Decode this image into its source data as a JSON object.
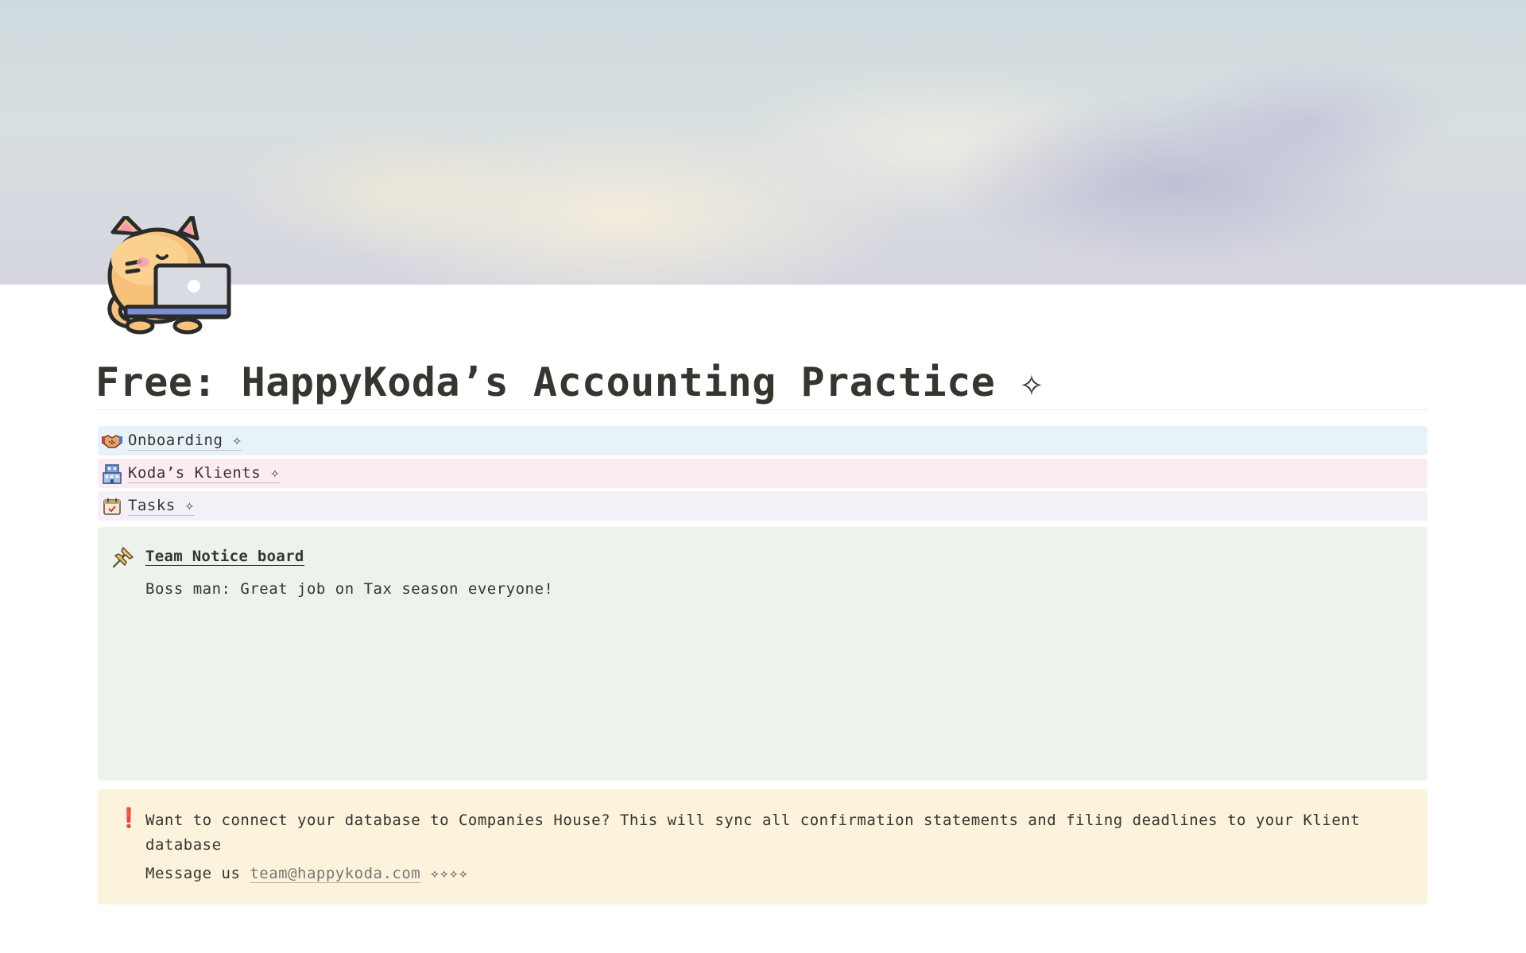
{
  "page": {
    "title": "Free: HappyKoda’s Accounting Practice ✧",
    "icon": "cat-with-laptop-icon"
  },
  "links": [
    {
      "label": "Onboarding ✧",
      "icon": "handshake-icon"
    },
    {
      "label": "Koda’s Klients ✧",
      "icon": "office-building-icon"
    },
    {
      "label": "Tasks ✧",
      "icon": "calendar-icon"
    }
  ],
  "notice_board": {
    "icon": "pushpin-icon",
    "heading": "Team Notice board",
    "body": "Boss man: Great job on Tax season everyone!"
  },
  "alert": {
    "icon": "exclamation-icon",
    "icon_glyph": "❗",
    "text": "Want to connect your database to Companies House? This will sync all confirmation statements and filing deadlines to your Klient database",
    "message_prefix": "Message us",
    "email": "team@happykoda.com",
    "message_suffix": "✧✧✧✧"
  },
  "colors": {
    "onboarding_bg": "#e7f3f8",
    "klients_bg": "#fbecf2",
    "tasks_bg": "#f4f0f7",
    "notice_bg": "#edf3ec",
    "alert_bg": "#fbf3db",
    "alert_icon": "#e03e3e",
    "text": "#37352f"
  }
}
